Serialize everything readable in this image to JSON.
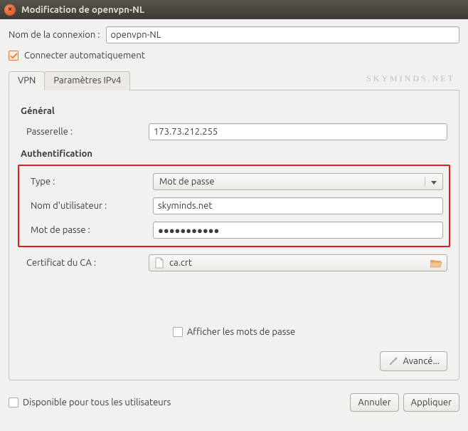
{
  "window": {
    "title": "Modification de openvpn-NL"
  },
  "connection_name": {
    "label": "Nom de la connexion :",
    "value": "openvpn-NL"
  },
  "autoconnect": {
    "label": "Connecter automatiquement",
    "checked": true
  },
  "watermark": "SKYMINDS.NET",
  "tabs": {
    "vpn": "VPN",
    "ipv4": "Paramètres IPv4"
  },
  "sections": {
    "general": "Général",
    "auth": "Authentification"
  },
  "gateway": {
    "label": "Passerelle :",
    "value": "173.73.212.255"
  },
  "auth": {
    "type_label": "Type :",
    "type_value": "Mot de passe",
    "user_label": "Nom d'utilisateur :",
    "user_value": "skyminds.net",
    "pass_label": "Mot de passe :",
    "pass_value": "●●●●●●●●●●●"
  },
  "ca": {
    "label": "Certificat du CA :",
    "filename": "ca.crt"
  },
  "show_passwords": {
    "label": "Afficher les mots de passe",
    "checked": false
  },
  "advanced_button": "Avancé...",
  "available_all_users": {
    "label": "Disponible pour tous les utilisateurs",
    "checked": false
  },
  "footer_buttons": {
    "cancel": "Annuler",
    "apply": "Appliquer"
  }
}
